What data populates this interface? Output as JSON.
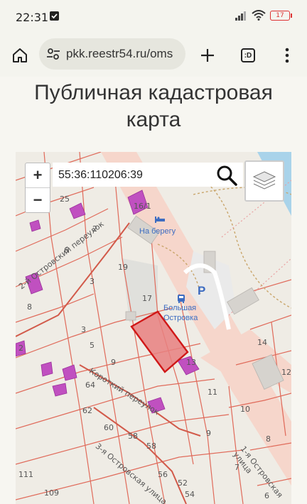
{
  "status_bar": {
    "time": "22:31",
    "battery": "17"
  },
  "browser": {
    "url": "pkk.reestr54.ru/oms",
    "tab_count": ":D"
  },
  "page": {
    "title_line1": "Публичная кадастровая",
    "title_line2": "карта"
  },
  "map": {
    "zoom_in": "+",
    "zoom_out": "−",
    "search_value": "55:36:110206:39",
    "street_labels": {
      "street1": "2-й Островский переулок",
      "street2": "Короткий переулок",
      "street3": "3-я Островская улица",
      "street4": "1-я Островская улица"
    },
    "poi": {
      "poi1": "На берегу",
      "poi2": "Большая",
      "poi3": "Островка"
    },
    "parking": "P",
    "parcel_numbers": [
      "25",
      "16/1",
      "2",
      "6",
      "19",
      "3",
      "17",
      "3",
      "5",
      "9",
      "8",
      "2",
      "13",
      "64",
      "62",
      "60",
      "58",
      "58",
      "56",
      "54",
      "52",
      "111",
      "109",
      "11",
      "14",
      "12",
      "10",
      "8",
      "9",
      "7",
      "6"
    ]
  },
  "colors": {
    "selected_parcel": "#e05050",
    "parcel_line": "#e06a5a",
    "building": "#c050c0",
    "road": "#f5d9cf"
  }
}
